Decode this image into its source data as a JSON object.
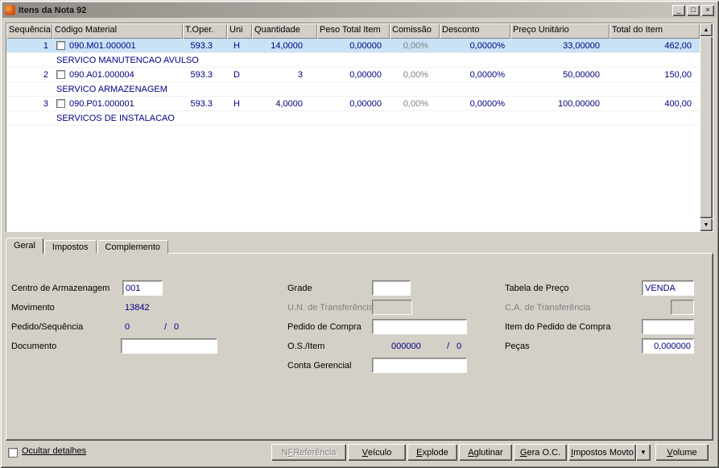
{
  "colors": {
    "chrome": "#d4d0c8",
    "selection": "#c9e2f6",
    "data_text": "#000080",
    "disabled_text": "#808080",
    "titlebar_start": "#8f8d86",
    "titlebar_end": "#c9c5bd"
  },
  "icons": {
    "scroll_up": "▲",
    "scroll_down": "▼",
    "dropdown": "▼"
  },
  "window": {
    "title": "Itens da Nota 92",
    "controls": {
      "minimize": "_",
      "maximize": "□",
      "close": "×"
    }
  },
  "grid": {
    "columns": [
      "Sequência",
      "Código Material",
      "T.Oper.",
      "Uni",
      "Quantidade",
      "Peso Total Item",
      "Comissão",
      "Desconto",
      "Preço Unitário",
      "Total do Item"
    ],
    "rows": [
      {
        "seq": "1",
        "code": "090.M01.000001",
        "toper": "593.3",
        "uni": "H",
        "qty": "14,0000",
        "peso": "0,00000",
        "comissao": "0,00%",
        "desconto": "0,0000%",
        "preco": "33,00000",
        "total": "462,00",
        "desc": "SERVICO MANUTENCAO AVULSO",
        "selected": true
      },
      {
        "seq": "2",
        "code": "090.A01.000004",
        "toper": "593.3",
        "uni": "D",
        "qty": "3",
        "peso": "0,00000",
        "comissao": "0,00%",
        "desconto": "0,0000%",
        "preco": "50,00000",
        "total": "150,00",
        "desc": "SERVICO ARMAZENAGEM",
        "selected": false
      },
      {
        "seq": "3",
        "code": "090.P01.000001",
        "toper": "593.3",
        "uni": "H",
        "qty": "4,0000",
        "peso": "0,00000",
        "comissao": "0,00%",
        "desconto": "0,0000%",
        "preco": "100,00000",
        "total": "400,00",
        "desc": "SERVICOS DE INSTALACAO",
        "selected": false
      }
    ]
  },
  "tabs": [
    {
      "label": "Geral",
      "active": true
    },
    {
      "label": "Impostos",
      "active": false
    },
    {
      "label": "Complemento",
      "active": false
    }
  ],
  "form": {
    "centro_armazenagem": {
      "label": "Centro de Armazenagem",
      "value": "001"
    },
    "movimento": {
      "label": "Movimento",
      "value": "13842"
    },
    "pedido_sequencia": {
      "label": "Pedido/Sequência",
      "value": "0",
      "sep": "/",
      "value2": "0"
    },
    "documento": {
      "label": "Documento",
      "value": ""
    },
    "grade": {
      "label": "Grade",
      "value": ""
    },
    "un_transferencia": {
      "label": "U.N. de Transferência",
      "value": ""
    },
    "pedido_compra": {
      "label": "Pedido de Compra",
      "value": ""
    },
    "os_item": {
      "label": "O.S./Item",
      "value": "000000",
      "sep": "/",
      "value2": "0"
    },
    "conta_gerencial": {
      "label": "Conta Gerencial",
      "value": ""
    },
    "tabela_preco": {
      "label": "Tabela de Preço",
      "value": "VENDA"
    },
    "ca_transferencia": {
      "label": "C.A. de Transferência",
      "value": ""
    },
    "item_pedido_compra": {
      "label": "Item do Pedido de Compra",
      "value": ""
    },
    "pecas": {
      "label": "Peças",
      "value": "0,000000"
    }
  },
  "footer": {
    "ocultar_detalhes": "Ocultar detalhes",
    "buttons": [
      {
        "label": "NF Referência",
        "mnemonic": "F",
        "disabled": true
      },
      {
        "label": "Veículo",
        "mnemonic": "V",
        "disabled": false
      },
      {
        "label": "Explode",
        "mnemonic": "E",
        "disabled": false
      },
      {
        "label": "Aglutinar",
        "mnemonic": "A",
        "disabled": false
      },
      {
        "label": "Gera O.C.",
        "mnemonic": "G",
        "disabled": false
      },
      {
        "label": "Impostos Movto",
        "mnemonic": "I",
        "disabled": false
      },
      {
        "label": "Volume",
        "mnemonic": "V",
        "disabled": false
      }
    ]
  }
}
